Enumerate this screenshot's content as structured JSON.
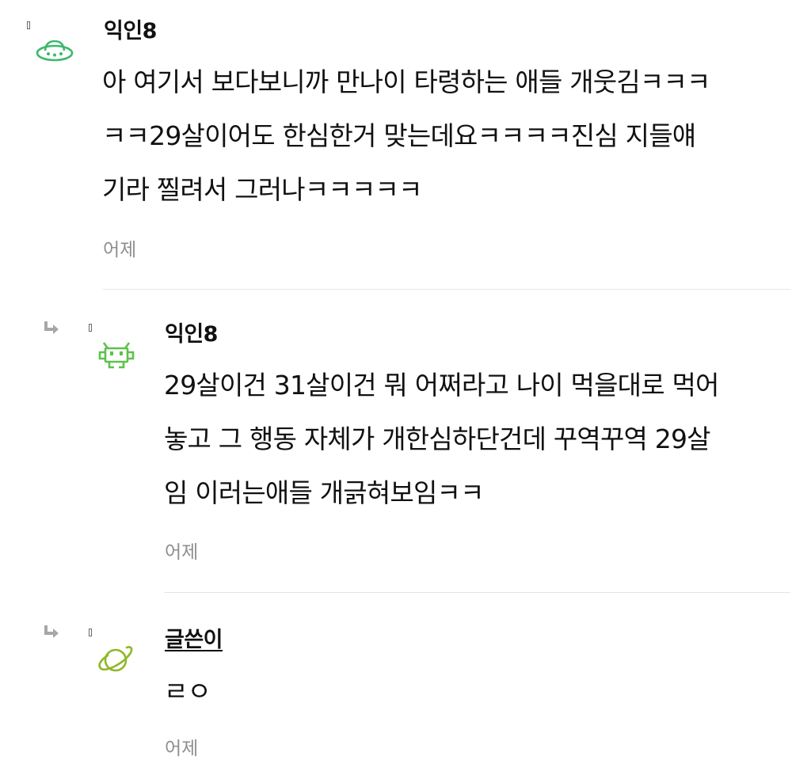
{
  "comments": [
    {
      "author": "익인8",
      "lines": [
        "아 여기서 보다보니까 만나이 타령하는 애들 개웃김ㅋㅋㅋ",
        "ㅋㅋ29살이어도 한심한거 맞는데요ㅋㅋㅋㅋ진심 지들얘",
        "기라 찔려서 그러나ㅋㅋㅋㅋㅋ"
      ],
      "time": "어제",
      "avatar_icon": "ufo-icon",
      "avatar_color": "#3db96b"
    },
    {
      "author": "익인8",
      "lines": [
        "29살이건 31살이건 뭐 어쩌라고 나이 먹을대로 먹어",
        "놓고 그 행동 자체가 개한심하단건데 꾸역꾸역 29살",
        "임 이러는애들 개긁혀보임ㅋㅋ"
      ],
      "time": "어제",
      "avatar_icon": "space-invader-icon",
      "avatar_color": "#5cc24a"
    },
    {
      "author": "글쓴이",
      "lines": [
        "ㄹㅇ"
      ],
      "time": "어제",
      "avatar_icon": "planet-icon",
      "avatar_color": "#8fb82a"
    }
  ]
}
